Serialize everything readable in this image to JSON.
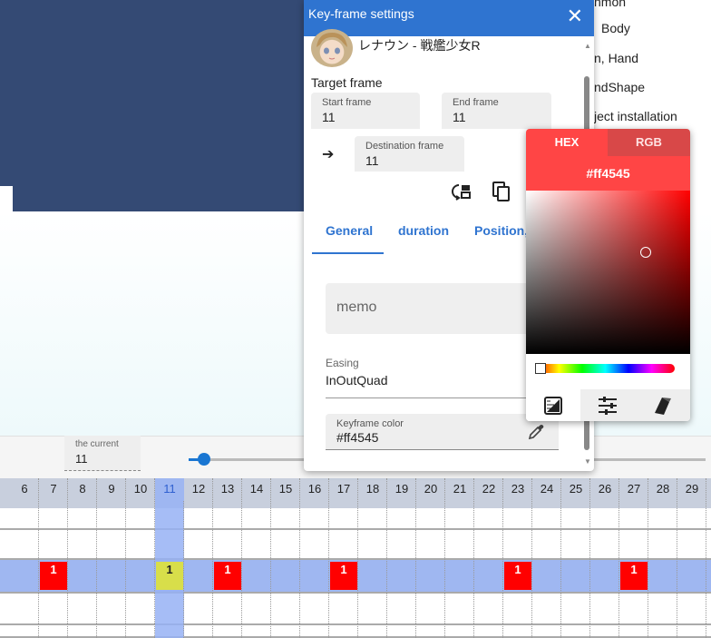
{
  "right_menu": {
    "items": [
      "nmon",
      "Body",
      "n, Hand",
      "ndShape",
      "ject installation"
    ]
  },
  "current": {
    "label": "the current",
    "value": "11"
  },
  "timeline": {
    "frames": [
      "6",
      "7",
      "8",
      "9",
      "10",
      "11",
      "12",
      "13",
      "14",
      "15",
      "16",
      "17",
      "18",
      "19",
      "20",
      "21",
      "22",
      "23",
      "24",
      "25",
      "26",
      "27",
      "28",
      "29"
    ],
    "current_frame": "11",
    "keyframe_label": "1",
    "keyframe_frames": [
      "7",
      "11",
      "13",
      "17",
      "23",
      "27"
    ],
    "colors": {
      "highlight": "#9fb7f1",
      "keyframe": "#ff0000",
      "current_keyframe": "#d8de4a"
    }
  },
  "dialog": {
    "title": "Key-frame settings",
    "character_name": "レナウン - 戦艦少女R",
    "target_label": "Target frame",
    "start": {
      "label": "Start frame",
      "value": "11"
    },
    "end": {
      "label": "End frame",
      "value": "11"
    },
    "destination": {
      "label": "Destination frame",
      "value": "11"
    },
    "tabs": [
      "General",
      "duration",
      "Position,R"
    ],
    "active_tab": "General",
    "memo_placeholder": "memo",
    "easing": {
      "label": "Easing",
      "value": "InOutQuad"
    },
    "keyframe_color": {
      "label": "Keyframe color",
      "value": "#ff4545"
    },
    "accent_color": "#2f74d0"
  },
  "picker": {
    "tabs": [
      "HEX",
      "RGB"
    ],
    "active_tab": "HEX",
    "hex_value": "#ff4545",
    "modes": [
      "palette-icon",
      "sliders-icon",
      "swatches-icon"
    ],
    "active_mode": "palette-icon"
  }
}
